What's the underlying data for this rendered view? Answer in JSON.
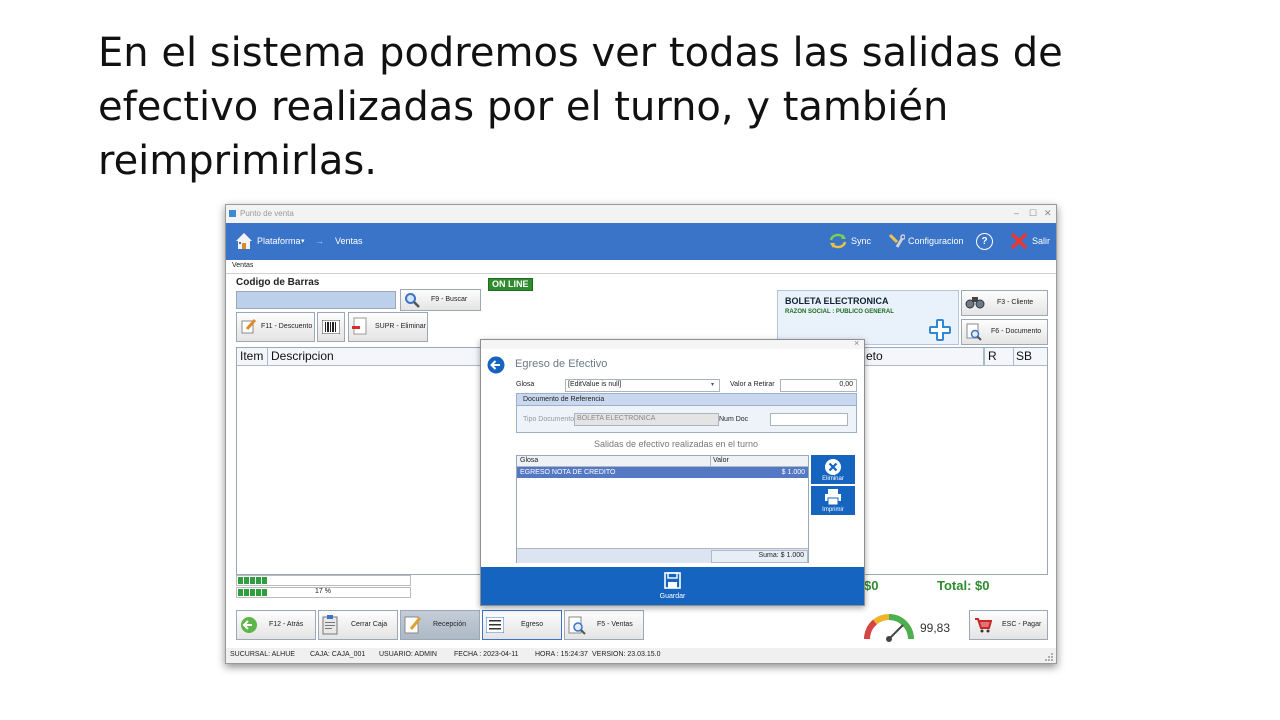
{
  "slide": {
    "title": "En el sistema podremos ver todas las salidas de efectivo realizadas por el turno, y también reimprimirlas."
  },
  "window": {
    "title": "Punto de venta",
    "controls": [
      "–",
      "☐",
      "✕"
    ]
  },
  "topbar": {
    "platform": "Plataforma",
    "platform_caret": "▾",
    "arrow": "→",
    "ventas": "Ventas",
    "sync": "Sync",
    "config": "Configuracion",
    "help": "?",
    "exit": "Salir",
    "color": "#3a74c9"
  },
  "tab": {
    "label": "Ventas"
  },
  "left": {
    "barcode_label": "Codigo de Barras",
    "buscar": "F9 - Buscar",
    "descuento": "F11 - Descuento",
    "eliminar": "SUPR - Eliminar"
  },
  "online": {
    "label": "ON LINE",
    "color": "#2e8b2e"
  },
  "doc_panel": {
    "title": "BOLETA ELECTRONICA",
    "sub": "RAZON SOCIAL   :  PUBLICO GENERAL",
    "cliente": "F3 - Cliente",
    "documento": "F6 - Documento"
  },
  "grid": {
    "headers": {
      "item": "Item",
      "desc": "Descripcion",
      "neto": "eto",
      "r": "R",
      "sb": "SB"
    }
  },
  "totals": {
    "left": "$0",
    "total": "Total: $0",
    "color": "#2e8b2e"
  },
  "progress": {
    "percent": "17 %",
    "value": 0.17
  },
  "bottom_buttons": {
    "atras": "F12 - Atrás",
    "cerrar": "Cerrar Caja",
    "recepcion": "Recepción",
    "egreso": "Egreso",
    "ventas": "F5 - Ventas",
    "pagar": "ESC - Pagar"
  },
  "gauge": {
    "value": "99,83"
  },
  "status": {
    "sucursal": "SUCURSAL: ALHUE",
    "caja": "CAJA: CAJA_001",
    "usuario": "USUARIO: ADMIN",
    "fecha": "FECHA : 2023-04-11",
    "hora": "HORA : 15:24:37",
    "version": "VERSION: 23.03.15.0"
  },
  "dialog": {
    "title": "Egreso de Efectivo",
    "close": "×",
    "glosa_label": "Glosa",
    "glosa_value": "[EditValue is null]",
    "valor_label": "Valor a Retirar",
    "valor_value": "0,00",
    "ref_title": "Documento de Referencia",
    "tipo_label": "Tipo Documento",
    "tipo_value": "BOLETA ELECTRONICA",
    "numdoc_label": "Num Doc",
    "numdoc_value": "",
    "section_title": "Salidas de efectivo realizadas en el turno",
    "table": {
      "headers": [
        "Glosa",
        "Valor"
      ],
      "rows": [
        {
          "glosa": "EGRESO NOTA DE CREDITO",
          "valor": "$ 1.000"
        }
      ],
      "sum": "Suma: $ 1.000"
    },
    "eliminar": "Eliminar",
    "imprimir": "Imprimir",
    "guardar": "Guardar",
    "accent": "#1565c0"
  }
}
